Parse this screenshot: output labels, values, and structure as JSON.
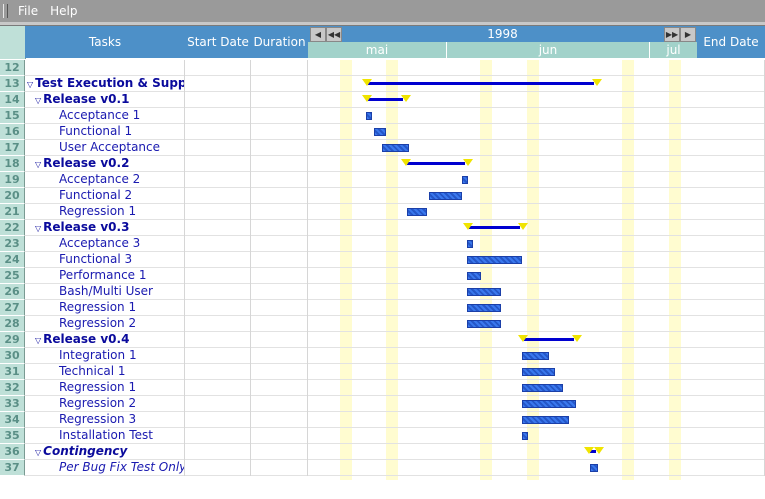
{
  "menu": {
    "file": "File",
    "help": "Help"
  },
  "columns": {
    "tasks": "Tasks",
    "start_date": "Start Date",
    "duration": "Duration",
    "end_date": "End Date"
  },
  "timeline": {
    "year": "1998",
    "months": [
      "mai",
      "jun",
      "jul"
    ]
  },
  "rows": [
    {
      "num": "12",
      "label": "",
      "level": "blank"
    },
    {
      "num": "13",
      "label": "Test Execution & Support",
      "level": "l0",
      "summary": [
        0.15,
        0.74
      ]
    },
    {
      "num": "14",
      "label": "Release v0.1",
      "level": "l1",
      "summary": [
        0.15,
        0.25
      ]
    },
    {
      "num": "15",
      "label": "Acceptance 1",
      "level": "l2",
      "task": [
        0.15,
        0.16
      ]
    },
    {
      "num": "16",
      "label": "Functional 1",
      "level": "l2",
      "task": [
        0.17,
        0.2
      ]
    },
    {
      "num": "17",
      "label": "User Acceptance",
      "level": "l2",
      "task": [
        0.19,
        0.26
      ]
    },
    {
      "num": "18",
      "label": "Release v0.2",
      "level": "l1",
      "summary": [
        0.25,
        0.41
      ]
    },
    {
      "num": "19",
      "label": "Acceptance 2",
      "level": "l2",
      "task": [
        0.395,
        0.41
      ]
    },
    {
      "num": "20",
      "label": "Functional 2",
      "level": "l2",
      "task": [
        0.31,
        0.395
      ]
    },
    {
      "num": "21",
      "label": "Regression 1",
      "level": "l2",
      "task": [
        0.255,
        0.305
      ]
    },
    {
      "num": "22",
      "label": "Release v0.3",
      "level": "l1",
      "summary": [
        0.41,
        0.55
      ]
    },
    {
      "num": "23",
      "label": "Acceptance 3",
      "level": "l2",
      "task": [
        0.41,
        0.425
      ]
    },
    {
      "num": "24",
      "label": "Functional 3",
      "level": "l2",
      "task": [
        0.41,
        0.55
      ]
    },
    {
      "num": "25",
      "label": "Performance 1",
      "level": "l2",
      "task": [
        0.41,
        0.445
      ]
    },
    {
      "num": "26",
      "label": "Bash/Multi User",
      "level": "l2",
      "task": [
        0.41,
        0.495
      ]
    },
    {
      "num": "27",
      "label": "Regression 1",
      "level": "l2",
      "task": [
        0.41,
        0.495
      ]
    },
    {
      "num": "28",
      "label": "Regression 2",
      "level": "l2",
      "task": [
        0.41,
        0.495
      ]
    },
    {
      "num": "29",
      "label": "Release v0.4",
      "level": "l1",
      "summary": [
        0.55,
        0.69
      ]
    },
    {
      "num": "30",
      "label": "Integration 1",
      "level": "l2",
      "task": [
        0.55,
        0.62
      ]
    },
    {
      "num": "31",
      "label": "Technical 1",
      "level": "l2",
      "task": [
        0.55,
        0.635
      ]
    },
    {
      "num": "32",
      "label": "Regression 1",
      "level": "l2",
      "task": [
        0.55,
        0.655
      ]
    },
    {
      "num": "33",
      "label": "Regression 2",
      "level": "l2",
      "task": [
        0.55,
        0.69
      ]
    },
    {
      "num": "34",
      "label": "Regression 3",
      "level": "l2",
      "task": [
        0.55,
        0.67
      ]
    },
    {
      "num": "35",
      "label": "Installation Test",
      "level": "l2",
      "task": [
        0.55,
        0.565
      ]
    },
    {
      "num": "36",
      "label": "Contingency",
      "level": "l1",
      "italic": true,
      "summary": [
        0.72,
        0.745
      ]
    },
    {
      "num": "37",
      "label": "Per Bug Fix Test Only",
      "level": "l2",
      "italic": true,
      "task": [
        0.725,
        0.745
      ]
    }
  ],
  "colors": {
    "header": "#4d90c8",
    "month_strip": "#a2d2ca",
    "row_number_bg": "#bfe0d8",
    "summary_bar": "#0000d0",
    "task_bar": "#2f6ae0",
    "milestone": "#f0e400",
    "weekend_band": "#fffcd0"
  }
}
